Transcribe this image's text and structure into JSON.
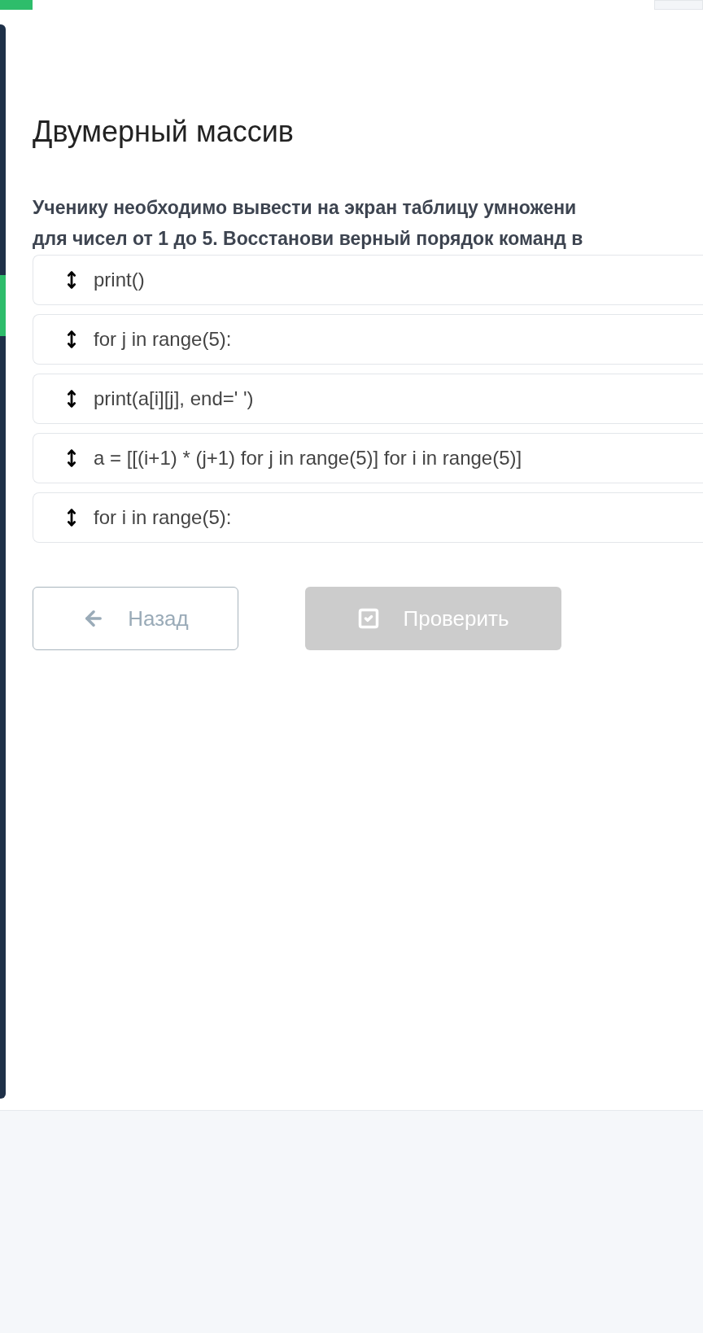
{
  "progress": {
    "level": 0.05
  },
  "title": "Двумерный массив",
  "question": "Ученику необходимо вывести на экран таблицу умножени\nдля чисел от 1 до 5. Восстанови верный порядок команд в",
  "items": [
    {
      "text": "print()"
    },
    {
      "text": "for j in range(5):"
    },
    {
      "text": "print(a[i][j], end=' ')"
    },
    {
      "text": "a = [[(i+1) * (j+1) for j in range(5)] for i in range(5)]"
    },
    {
      "text": "for i in range(5):"
    }
  ],
  "buttons": [
    {
      "kind": "back",
      "label": "Назад",
      "disabled": false
    },
    {
      "kind": "check",
      "label": "Проверить",
      "disabled": true
    }
  ]
}
